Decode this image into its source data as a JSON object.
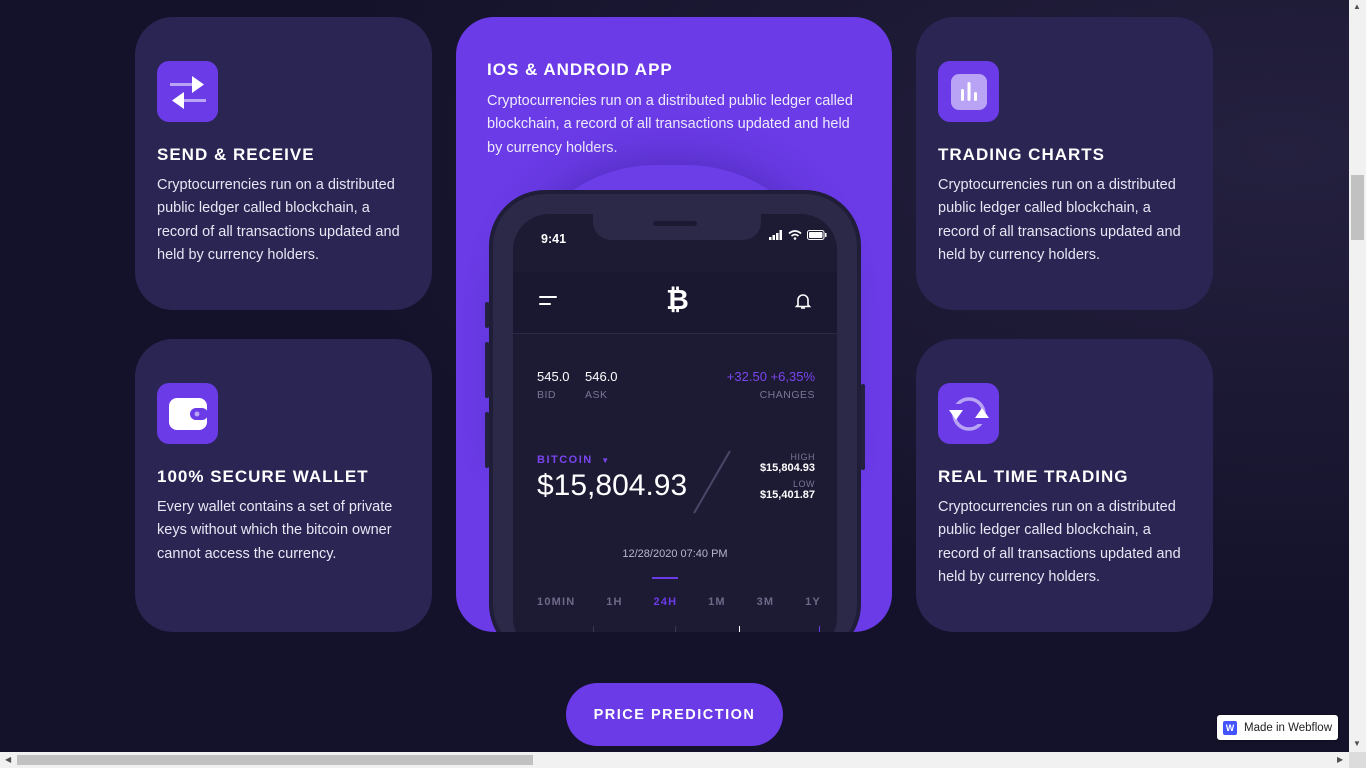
{
  "features": {
    "send_receive": {
      "title": "SEND & RECEIVE",
      "text": "Cryptocurrencies run on a distributed public ledger called blockchain, a record of all transactions updated and held by currency holders.",
      "icon": "swap-arrows-icon"
    },
    "secure_wallet": {
      "title": "100% SECURE WALLET",
      "text": "Every wallet contains a set of private keys without which the bitcoin owner cannot access the currency.",
      "icon": "wallet-icon"
    },
    "trading_charts": {
      "title": "TRADING CHARTS",
      "text": "Cryptocurrencies run on a distributed public ledger called blockchain, a record of all transactions updated and held by currency holders.",
      "icon": "bar-chart-icon"
    },
    "real_time": {
      "title": "REAL TIME TRADING",
      "text": "Cryptocurrencies run on a distributed public ledger called blockchain, a record of all transactions updated and held by currency holders.",
      "icon": "refresh-icon"
    },
    "app": {
      "title": "IOS & ANDROID APP",
      "text": "Cryptocurrencies run on a distributed public ledger called blockchain, a record of all transactions updated and held by currency holders."
    }
  },
  "phone": {
    "time": "9:41",
    "logo": "₿",
    "bid_value": "545.0",
    "bid_label": "BID",
    "ask_value": "546.0",
    "ask_label": "ASK",
    "change_abs": "+32.50",
    "change_pct": "+6,35%",
    "changes_label": "CHANGES",
    "coin": "BITCOIN",
    "price": "$15,804.93",
    "high_label": "HIGH",
    "high_value": "$15,804.93",
    "low_label": "LOW",
    "low_value": "$15,401.87",
    "datetime": "12/28/2020 07:40 PM",
    "ranges": [
      "10MIN",
      "1H",
      "24H",
      "1M",
      "3M",
      "1Y"
    ],
    "active_range": "24H"
  },
  "cta": {
    "label": "PRICE PREDICTION"
  },
  "badge": {
    "label": "Made in Webflow",
    "logo": "W"
  },
  "colors": {
    "accent": "#6a3be6",
    "card": "#2a2553",
    "background": "#14122a"
  }
}
